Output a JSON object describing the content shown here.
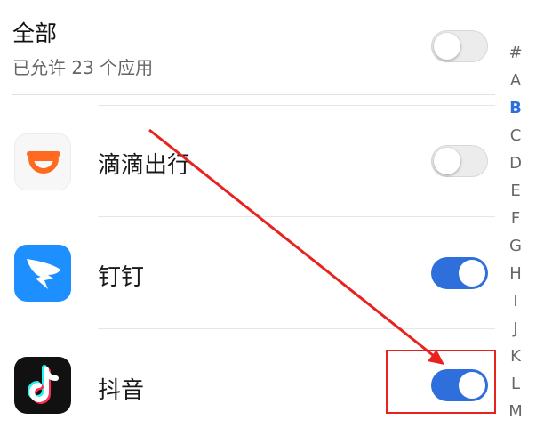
{
  "header": {
    "title": "全部",
    "subtitle": "已允许 23 个应用",
    "master_toggle_on": false
  },
  "apps": [
    {
      "name": "滴滴出行",
      "icon": "didi-chuxing-icon",
      "enabled": false
    },
    {
      "name": "钉钉",
      "icon": "dingtalk-icon",
      "enabled": true
    },
    {
      "name": "抖音",
      "icon": "douyin-icon",
      "enabled": true
    }
  ],
  "index_bar": {
    "letters": [
      "#",
      "A",
      "B",
      "C",
      "D",
      "E",
      "F",
      "G",
      "H",
      "I",
      "J",
      "K",
      "L",
      "M"
    ],
    "active": "B"
  },
  "colors": {
    "toggle_on": "#2f6fdc",
    "toggle_off": "#ececec",
    "annotation": "#e8231f",
    "didi_orange": "#ff6a1f",
    "dingtalk_blue": "#1e8fff",
    "douyin_bg": "#111111"
  }
}
